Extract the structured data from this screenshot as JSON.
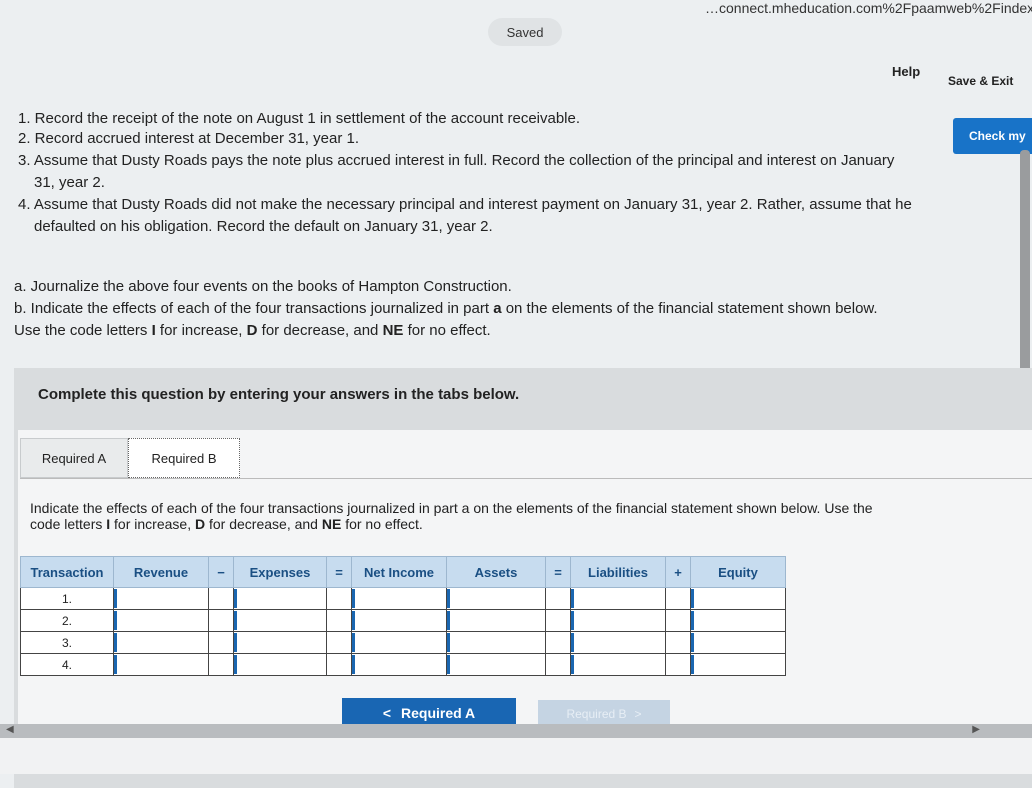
{
  "browser": {
    "url": "…connect.mheducation.com%2Fpaamweb%2Findex.h"
  },
  "header": {
    "saved_label": "Saved",
    "help_label": "Help",
    "save_exit_label": "Save & Exit",
    "check_label": "Check my"
  },
  "question": {
    "line1": "1. Record the receipt of the note on August 1 in settlement of the account receivable.",
    "line2": "2. Record accrued interest at December 31, year 1.",
    "line3a": "3. Assume that Dusty Roads pays the note plus accrued interest in full. Record the collection of the principal and interest on January",
    "line3b": "31, year 2.",
    "line4a": "4. Assume that Dusty Roads did not make the necessary principal and interest payment on January 31, year 2. Rather, assume that he",
    "line4b": "defaulted on his obligation. Record the default on January 31, year 2.",
    "part_a": "a. Journalize the above four events on the books of Hampton Construction.",
    "part_b_1": "b. Indicate the effects of each of the four transactions journalized in part",
    "part_b_bold": "a",
    "part_b_2": "on the elements of the financial statement shown below.",
    "codes_1": "Use the code letters",
    "codes_I": "I",
    "codes_2": "for increase,",
    "codes_D": "D",
    "codes_3": "for decrease, and",
    "codes_NE": "NE",
    "codes_4": "for no effect."
  },
  "complete_text": "Complete this question by entering your answers in the tabs below.",
  "tabs": [
    {
      "label": "Required A"
    },
    {
      "label": "Required B"
    }
  ],
  "instruction": {
    "line1": "Indicate the effects of each of the four transactions journalized in part a on the elements of the financial statement shown below. Use the",
    "line2_1": "code letters",
    "I": "I",
    "line2_2": "for increase,",
    "D": "D",
    "line2_3": "for decrease, and",
    "NE": "NE",
    "line2_4": "for no effect."
  },
  "table": {
    "headers": {
      "transaction": "Transaction",
      "revenue": "Revenue",
      "minus": "−",
      "expenses": "Expenses",
      "equals1": "=",
      "net_income": "Net Income",
      "assets": "Assets",
      "equals2": "=",
      "liabilities": "Liabilities",
      "plus": "+",
      "equity": "Equity"
    },
    "rows": [
      "1.",
      "2.",
      "3.",
      "4."
    ]
  },
  "nav": {
    "prev_arrow": "<",
    "prev_label": "Required A",
    "next_label": "Required B",
    "next_arrow": ">"
  }
}
